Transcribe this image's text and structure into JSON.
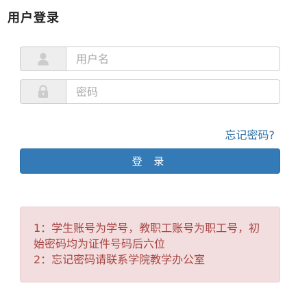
{
  "header": {
    "title": "用户登录"
  },
  "form": {
    "username": {
      "icon": "user-icon",
      "placeholder": "用户名",
      "value": ""
    },
    "password": {
      "icon": "lock-icon",
      "placeholder": "密码",
      "value": ""
    },
    "forgot_link": "忘记密码?",
    "login_label": "登 录"
  },
  "notice": {
    "line1": "1：学生账号为学号，教职工账号为职工号，初始密码均为证件号码后六位",
    "line2": "2：忘记密码请联系学院教学办公室"
  },
  "colors": {
    "primary": "#337ab7",
    "link": "#2d6ea5",
    "notice_bg": "#f2dede",
    "notice_border": "#ebccd1",
    "notice_text": "#a94442",
    "addon_bg": "#eeeeee",
    "icon": "#cccccc"
  }
}
